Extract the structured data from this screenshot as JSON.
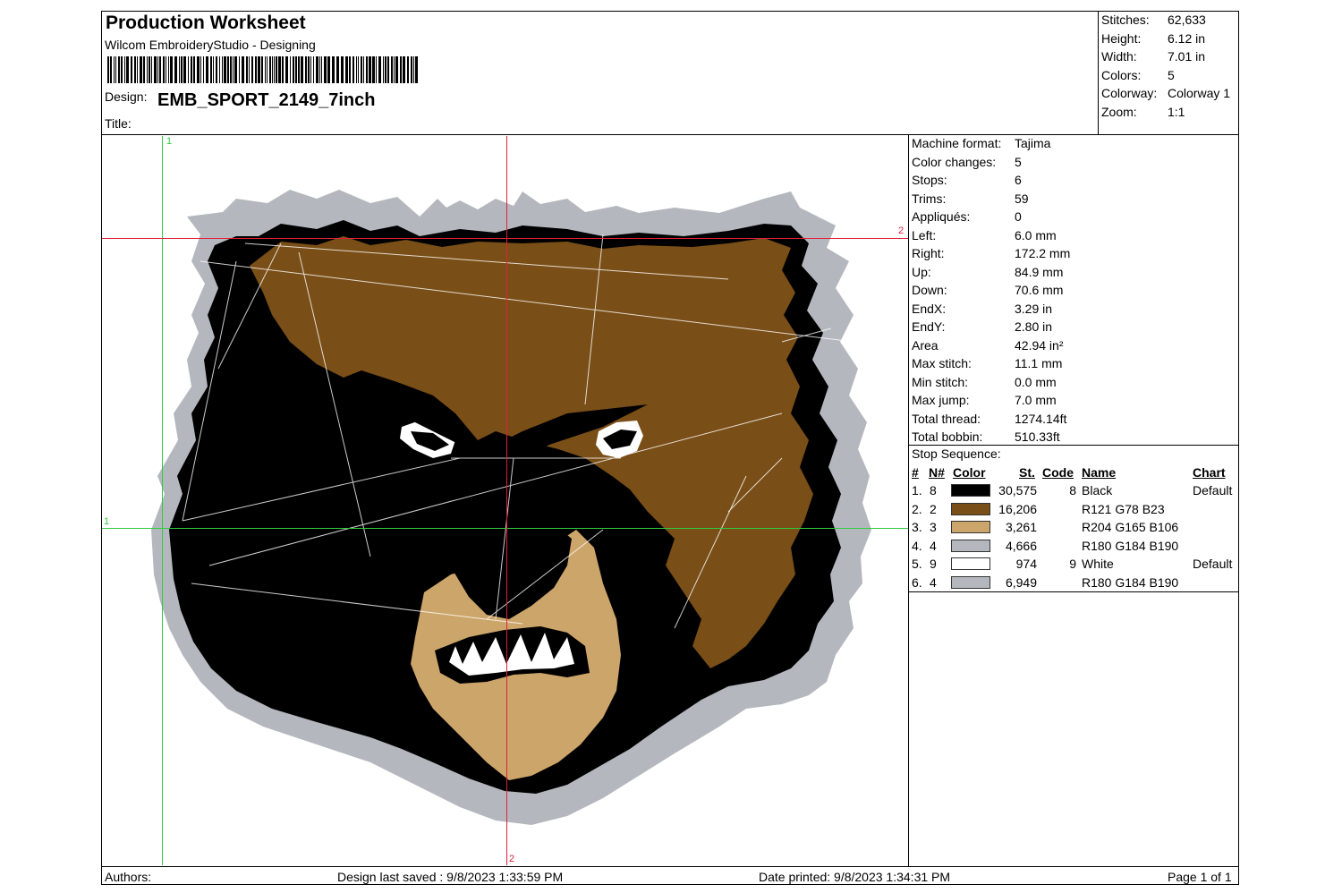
{
  "header": {
    "title": "Production Worksheet",
    "app": "Wilcom EmbroideryStudio - Designing",
    "design_label": "Design:",
    "design_name": "EMB_SPORT_2149_7inch",
    "title_label": "Title:"
  },
  "summary": {
    "stitches_label": "Stitches:",
    "stitches": "62,633",
    "height_label": "Height:",
    "height": "6.12 in",
    "width_label": "Width:",
    "width": "7.01 in",
    "colors_label": "Colors:",
    "colors": "5",
    "colorway_label": "Colorway:",
    "colorway": "Colorway 1",
    "zoom_label": "Zoom:",
    "zoom": "1:1"
  },
  "stats": [
    {
      "label": "Machine format:",
      "value": "Tajima"
    },
    {
      "label": "Color changes:",
      "value": "5"
    },
    {
      "label": "Stops:",
      "value": "6"
    },
    {
      "label": "Trims:",
      "value": "59"
    },
    {
      "label": "Appliqués:",
      "value": "0"
    },
    {
      "label": "Left:",
      "value": "6.0 mm"
    },
    {
      "label": "Right:",
      "value": "172.2 mm"
    },
    {
      "label": "Up:",
      "value": "84.9 mm"
    },
    {
      "label": "Down:",
      "value": "70.6 mm"
    },
    {
      "label": "EndX:",
      "value": "3.29 in"
    },
    {
      "label": "EndY:",
      "value": "2.80 in"
    },
    {
      "label": "Area",
      "value": " 42.94 in²"
    },
    {
      "label": "Max stitch:",
      "value": "11.1 mm"
    },
    {
      "label": "Min stitch:",
      "value": "0.0 mm"
    },
    {
      "label": "Max jump:",
      "value": "7.0 mm"
    },
    {
      "label": "Total thread:",
      "value": "1274.14ft"
    },
    {
      "label": "Total bobbin:",
      "value": "510.33ft"
    }
  ],
  "stop_sequence": {
    "label": "Stop Sequence:",
    "headers": {
      "idx": "#",
      "needle": "N#",
      "color": "Color",
      "st": "St.",
      "code": "Code",
      "name": "Name",
      "chart": "Chart"
    },
    "rows": [
      {
        "idx": "1.",
        "needle": "8",
        "swatch": "#000000",
        "st": "30,575",
        "code": "8",
        "name": "Black",
        "chart": "Default"
      },
      {
        "idx": "2.",
        "needle": "2",
        "swatch": "#794E17",
        "st": "16,206",
        "code": "",
        "name": "R121 G78 B23",
        "chart": ""
      },
      {
        "idx": "3.",
        "needle": "3",
        "swatch": "#CCA56A",
        "st": "3,261",
        "code": "",
        "name": "R204 G165 B106",
        "chart": ""
      },
      {
        "idx": "4.",
        "needle": "4",
        "swatch": "#B4B8BE",
        "st": "4,666",
        "code": "",
        "name": "R180 G184 B190",
        "chart": ""
      },
      {
        "idx": "5.",
        "needle": "9",
        "swatch": "#FFFFFF",
        "st": "974",
        "code": "9",
        "name": "White",
        "chart": "Default"
      },
      {
        "idx": "6.",
        "needle": "4",
        "swatch": "#B4B8BE",
        "st": "6,949",
        "code": "",
        "name": "R180 G184 B190",
        "chart": ""
      }
    ]
  },
  "guides": {
    "v1": "1",
    "h1": "1",
    "v2": "2",
    "h2": "2"
  },
  "footer": {
    "authors": "Authors:",
    "saved": "Design last saved : 9/8/2023 1:33:59 PM",
    "printed": "Date printed: 9/8/2023 1:34:31 PM",
    "page": "Page 1 of 1"
  }
}
